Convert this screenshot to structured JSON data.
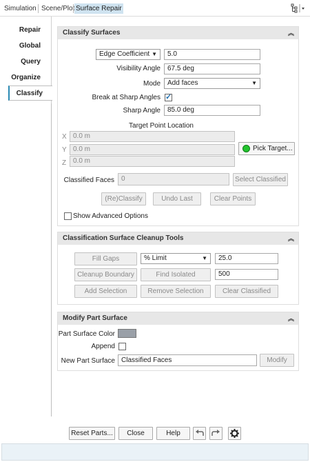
{
  "topbar": {
    "tabs": [
      "Simulation",
      "Scene/Plot",
      "Surface Repair"
    ],
    "active_tab": "Surface Repair"
  },
  "nav": {
    "items": [
      "Repair",
      "Global",
      "Query",
      "Organize",
      "Classify"
    ],
    "active": "Classify"
  },
  "classify": {
    "title": "Classify Surfaces",
    "edge_select": "Edge Coefficient",
    "edge_value": "5.0",
    "visibility_label": "Visibility Angle",
    "visibility_value": "67.5 deg",
    "mode_label": "Mode",
    "mode_value": "Add faces",
    "break_label": "Break at Sharp Angles",
    "break_checked": true,
    "sharp_label": "Sharp Angle",
    "sharp_value": "85.0 deg",
    "target_label": "Target Point Location",
    "x_label": "X",
    "x_value": "0.0 m",
    "y_label": "Y",
    "y_value": "0.0 m",
    "z_label": "Z",
    "z_value": "0.0 m",
    "pick_target": "Pick Target...",
    "classified_faces_label": "Classified Faces",
    "classified_faces_value": "0",
    "select_classified": "Select Classified",
    "reclassify": "(Re)Classify",
    "undo_last": "Undo Last",
    "clear_points": "Clear Points",
    "show_advanced": "Show Advanced Options"
  },
  "cleanup": {
    "title": "Classification Surface Cleanup Tools",
    "fill_gaps": "Fill Gaps",
    "limit_select": "% Limit",
    "limit_value": "25.0",
    "cleanup_boundary": "Cleanup Boundary",
    "find_isolated": "Find Isolated",
    "isolated_value": "500",
    "add_selection": "Add Selection",
    "remove_selection": "Remove Selection",
    "clear_classified": "Clear Classified"
  },
  "modify": {
    "title": "Modify Part Surface",
    "color_label": "Part Surface Color",
    "swatch_color": "#9aa0a8",
    "append_label": "Append",
    "new_part_label": "New Part Surface",
    "new_part_value": "Classified Faces",
    "modify_button": "Modify"
  },
  "bottom": {
    "reset_parts": "Reset Parts...",
    "close": "Close",
    "help": "Help"
  }
}
